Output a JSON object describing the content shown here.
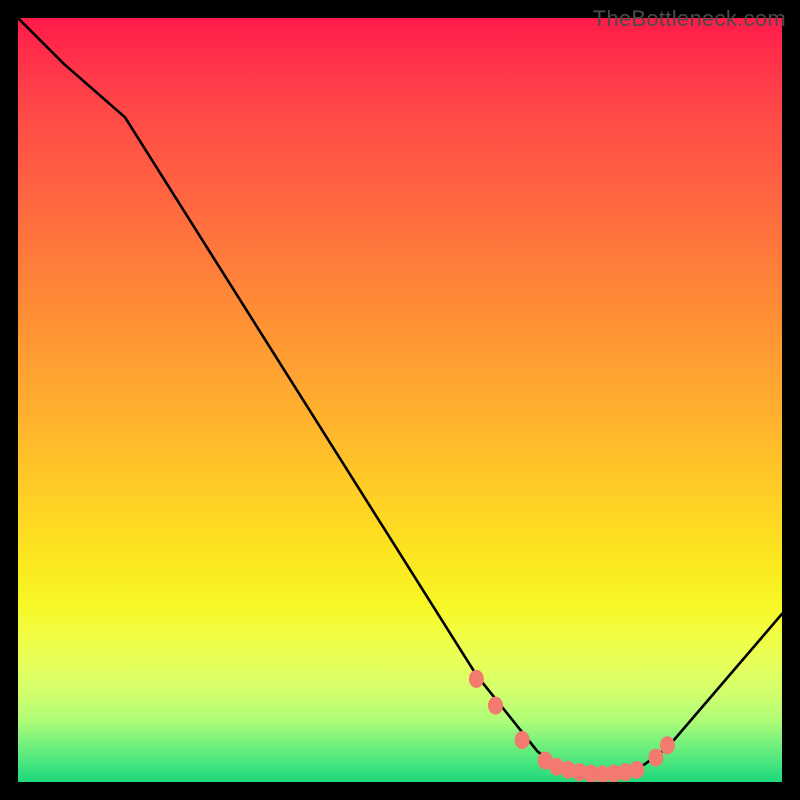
{
  "watermark": "TheBottleneck.com",
  "chart_data": {
    "type": "line",
    "title": "",
    "xlabel": "",
    "ylabel": "",
    "xlim": [
      0,
      100
    ],
    "ylim": [
      0,
      100
    ],
    "series": [
      {
        "name": "curve",
        "x": [
          0,
          6,
          14,
          60,
          64,
          68,
          70,
          72,
          75,
          78,
          80,
          82,
          85,
          100
        ],
        "y": [
          100,
          94,
          87,
          14,
          9,
          4,
          2.5,
          1.6,
          1.0,
          1.0,
          1.3,
          2.3,
          4.5,
          22
        ]
      }
    ],
    "markers": [
      {
        "x": 60.0,
        "y": 13.5
      },
      {
        "x": 62.5,
        "y": 10.0
      },
      {
        "x": 66.0,
        "y": 5.5
      },
      {
        "x": 69.0,
        "y": 2.8
      },
      {
        "x": 70.5,
        "y": 2.0
      },
      {
        "x": 72.0,
        "y": 1.6
      },
      {
        "x": 73.5,
        "y": 1.3
      },
      {
        "x": 75.0,
        "y": 1.1
      },
      {
        "x": 76.5,
        "y": 1.0
      },
      {
        "x": 78.0,
        "y": 1.1
      },
      {
        "x": 79.5,
        "y": 1.3
      },
      {
        "x": 81.0,
        "y": 1.6
      },
      {
        "x": 83.5,
        "y": 3.2
      },
      {
        "x": 85.0,
        "y": 4.8
      }
    ],
    "gradient_stops": [
      {
        "pct": 0,
        "color": "#ff1a4a"
      },
      {
        "pct": 25,
        "color": "#ff6a3f"
      },
      {
        "pct": 52,
        "color": "#ffb12e"
      },
      {
        "pct": 77,
        "color": "#f6f828"
      },
      {
        "pct": 95,
        "color": "#74f07c"
      },
      {
        "pct": 100,
        "color": "#1fd87c"
      }
    ],
    "marker_color": "#f37a6e",
    "curve_color": "#000000"
  }
}
